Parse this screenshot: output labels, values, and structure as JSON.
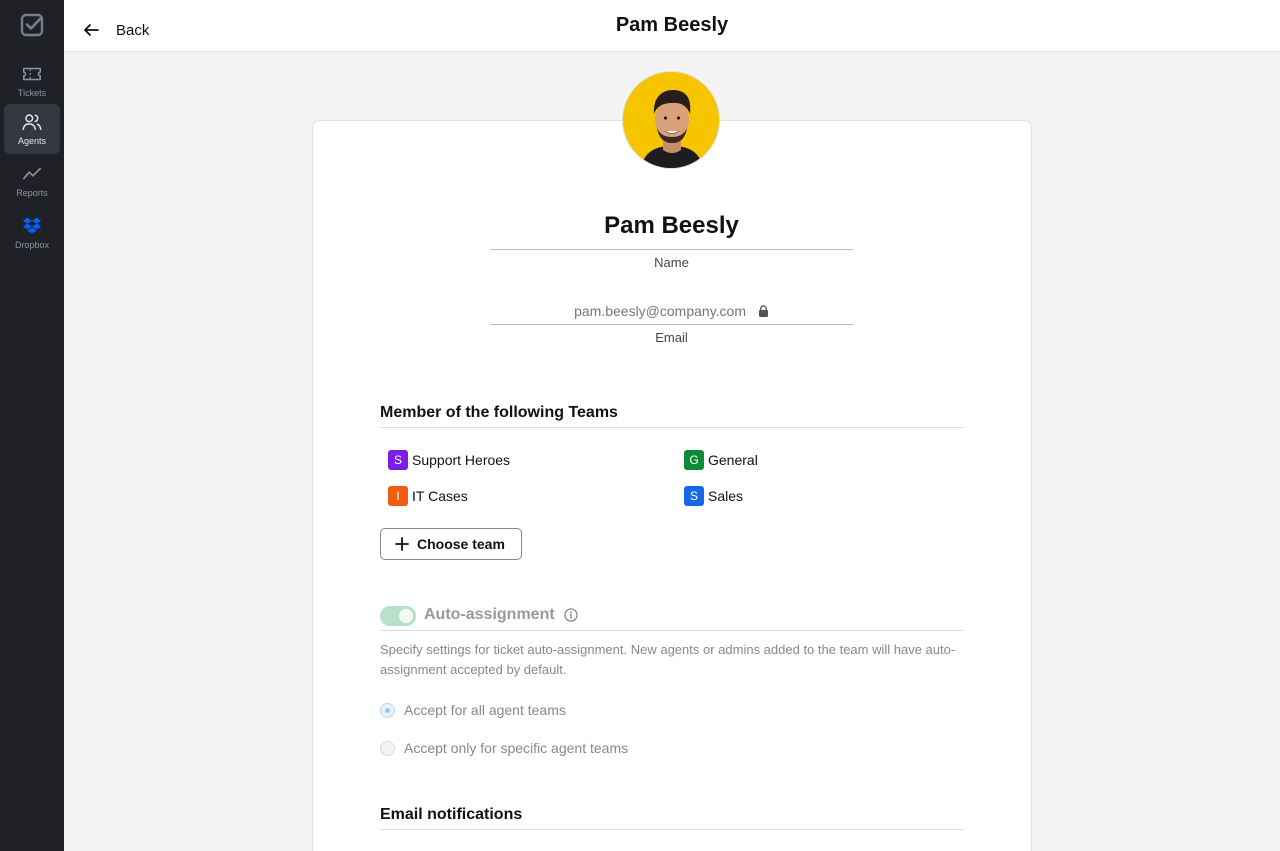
{
  "sidebar": {
    "items": [
      {
        "label": "Tickets"
      },
      {
        "label": "Agents"
      },
      {
        "label": "Reports"
      },
      {
        "label": "Dropbox"
      }
    ]
  },
  "header": {
    "back_label": "Back",
    "title": "Pam Beesly"
  },
  "profile": {
    "name": "Pam Beesly",
    "name_label": "Name",
    "email": "pam.beesly@company.com",
    "email_label": "Email"
  },
  "teams": {
    "title": "Member of the following Teams",
    "items": [
      {
        "initial": "S",
        "name": "Support Heroes",
        "color": "#7c1de6"
      },
      {
        "initial": "G",
        "name": "General",
        "color": "#0e8a3a"
      },
      {
        "initial": "I",
        "name": "IT Cases",
        "color": "#f25a0f"
      },
      {
        "initial": "S",
        "name": "Sales",
        "color": "#1668e3"
      }
    ],
    "choose_label": "Choose team"
  },
  "auto_assignment": {
    "title": "Auto-assignment",
    "enabled": true,
    "description": "Specify settings for ticket auto-assignment. New agents or admins added to the team will have auto-assignment accepted by default.",
    "options": [
      {
        "label": "Accept for all agent teams",
        "selected": true
      },
      {
        "label": "Accept only for specific agent teams",
        "selected": false
      }
    ]
  },
  "email_notifications": {
    "title": "Email notifications"
  },
  "colors": {
    "sidebar_bg": "#1f2126",
    "toggle_on": "#b7e2c7",
    "accent_dropbox": "#0061fe"
  }
}
